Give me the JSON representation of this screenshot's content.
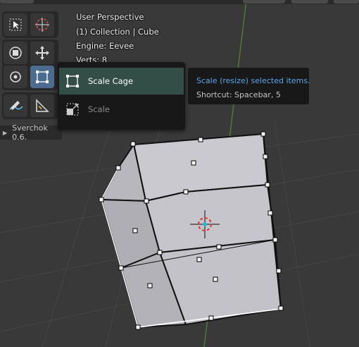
{
  "viewport": {
    "view_name": "User Perspective",
    "collection": "(1) Collection | Cube",
    "engine": "Engine: Eevee",
    "verts": "Verts: 8"
  },
  "toolbar": {
    "tools": [
      {
        "name": "select-box",
        "icon": "select-box-icon"
      },
      {
        "name": "cursor",
        "icon": "cursor-icon"
      },
      {
        "name": "move",
        "icon": "move-icon"
      },
      {
        "name": "transform",
        "icon": "transform-icon"
      },
      {
        "name": "rotate",
        "icon": "rotate-icon"
      },
      {
        "name": "scale-cage",
        "icon": "scale-cage-icon",
        "active": true
      },
      {
        "name": "annotate",
        "icon": "annotate-icon"
      },
      {
        "name": "measure",
        "icon": "measure-icon"
      }
    ]
  },
  "popup_menu": {
    "items": [
      {
        "label": "Scale Cage",
        "icon": "scale-cage-icon",
        "highlighted": true
      },
      {
        "label": "Scale",
        "icon": "scale-icon",
        "highlighted": false
      }
    ]
  },
  "tooltip": {
    "description": "Scale (resize) selected items.",
    "shortcut": "Shortcut: Spacebar, 5"
  },
  "addon_panel": {
    "label": "Sverchok 0.6."
  },
  "colors": {
    "background": "#393939",
    "active_tool": "#4b6c8f",
    "highlight_item": "#334d47",
    "tooltip_title": "#5aa6e8",
    "y_axis": "#5a7a3a"
  }
}
